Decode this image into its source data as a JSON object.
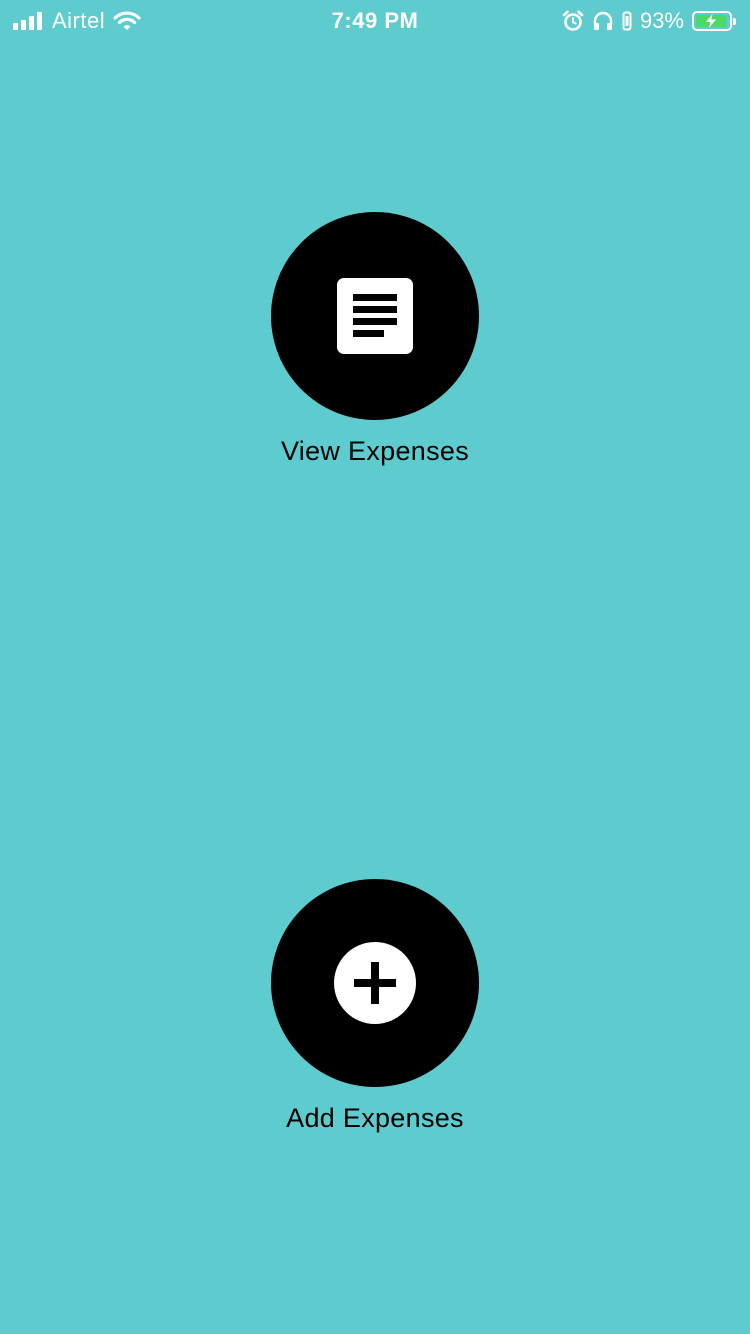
{
  "status_bar": {
    "carrier": "Airtel",
    "time": "7:49 PM",
    "battery_percent": "93%",
    "battery_level": 0.93,
    "charging": true,
    "icons": [
      "signal-icon",
      "wifi-icon",
      "alarm-icon",
      "headphones-icon",
      "orientation-lock-icon",
      "battery-icon"
    ]
  },
  "actions": {
    "view": {
      "label": "View Expenses",
      "icon": "document-list-icon"
    },
    "add": {
      "label": "Add Expenses",
      "icon": "plus-circle-icon"
    }
  },
  "colors": {
    "background": "#5ECCCE",
    "button": "#000000",
    "icon": "#FFFFFF",
    "battery_fill": "#4CD964"
  }
}
